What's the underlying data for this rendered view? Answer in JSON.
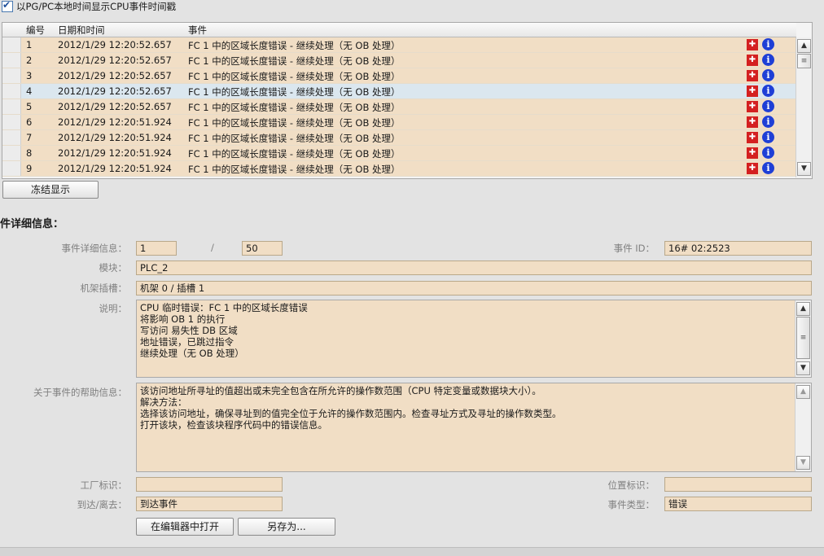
{
  "top_option": {
    "label": "以PG/PC本地时间显示CPU事件时间戳",
    "checked": true
  },
  "table": {
    "headers": {
      "number": "编号",
      "datetime": "日期和时间",
      "event": "事件"
    },
    "rows": [
      {
        "number": "1",
        "datetime": "2012/1/29 12:20:52.657",
        "event": "FC 1 中的区域长度错误 - 继续处理（无 OB 处理）"
      },
      {
        "number": "2",
        "datetime": "2012/1/29 12:20:52.657",
        "event": "FC 1 中的区域长度错误 - 继续处理（无 OB 处理）"
      },
      {
        "number": "3",
        "datetime": "2012/1/29 12:20:52.657",
        "event": "FC 1 中的区域长度错误 - 继续处理（无 OB 处理）"
      },
      {
        "number": "4",
        "datetime": "2012/1/29 12:20:52.657",
        "event": "FC 1 中的区域长度错误 - 继续处理（无 OB 处理）"
      },
      {
        "number": "5",
        "datetime": "2012/1/29 12:20:52.657",
        "event": "FC 1 中的区域长度错误 - 继续处理（无 OB 处理）"
      },
      {
        "number": "6",
        "datetime": "2012/1/29 12:20:51.924",
        "event": "FC 1 中的区域长度错误 - 继续处理（无 OB 处理）"
      },
      {
        "number": "7",
        "datetime": "2012/1/29 12:20:51.924",
        "event": "FC 1 中的区域长度错误 - 继续处理（无 OB 处理）"
      },
      {
        "number": "8",
        "datetime": "2012/1/29 12:20:51.924",
        "event": "FC 1 中的区域长度错误 - 继续处理（无 OB 处理）"
      },
      {
        "number": "9",
        "datetime": "2012/1/29 12:20:51.924",
        "event": "FC 1 中的区域长度错误 - 继续处理（无 OB 处理）"
      }
    ],
    "row_icons": [
      "wrench-icon",
      "info-icon"
    ]
  },
  "freeze_button": "冻结显示",
  "details": {
    "title": "件详细信息：",
    "labels": {
      "event_detail": "事件详细信息：",
      "slash": "/",
      "event_id": "事件 ID：",
      "module": "模块：",
      "rack_slot": "机架插槽：",
      "description": "说明：",
      "help": "关于事件的帮助信息：",
      "plant_tag": "工厂标识：",
      "location_tag": "位置标识：",
      "arrive_leave": "到达/离去：",
      "event_type": "事件类型："
    },
    "values": {
      "event_index": "1",
      "event_total": "50",
      "event_id": "16# 02:2523",
      "module": "PLC_2",
      "rack_slot": "机架 0 / 插槽 1",
      "description": "CPU 临时错误：FC 1 中的区域长度错误\n将影响 OB 1 的执行\n写访问 易失性 DB 区域\n地址错误，已跳过指令\n继续处理（无 OB 处理）",
      "help": "该访问地址所寻址的值超出或未完全包含在所允许的操作数范围（CPU 特定变量或数据块大小）。\n解决方法：\n选择该访问地址，确保寻址到的值完全位于允许的操作数范围内。检查寻址方式及寻址的操作数类型。\n打开该块，检查该块程序代码中的错误信息。",
      "plant_tag": "",
      "location_tag": "",
      "arrive_leave": "到达事件",
      "event_type": "错误"
    }
  },
  "buttons": {
    "open_editor": "在编辑器中打开",
    "save_as": "另存为..."
  },
  "scroll_glyphs": {
    "up": "▲",
    "down": "▼",
    "grip": "≡"
  },
  "colors": {
    "field_bg": "#f1dec5",
    "selected_row": "#dbe7ef",
    "wrench_red": "#d42020",
    "info_blue": "#1f3fd6"
  }
}
